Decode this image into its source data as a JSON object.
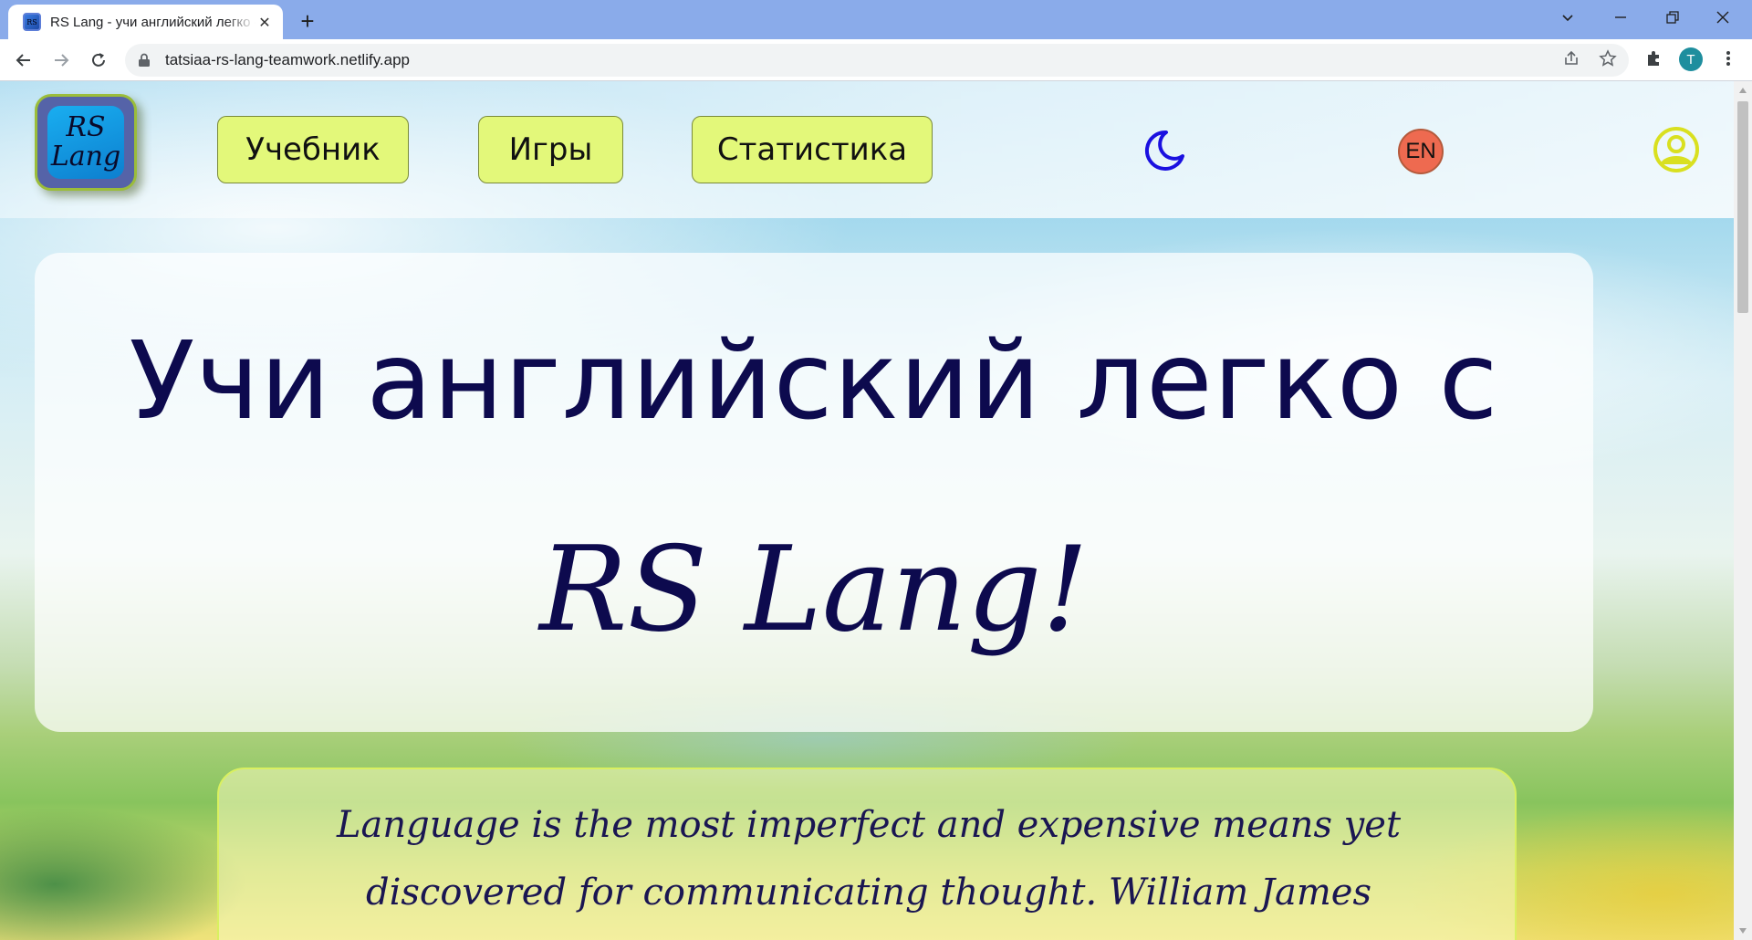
{
  "browser": {
    "tab_title": "RS Lang - учи английский легко с RS Lang!",
    "url": "tatsiaa-rs-lang-teamwork.netlify.app",
    "profile_initial": "T"
  },
  "header": {
    "logo_line1": "RS",
    "logo_line2": "Lang",
    "nav": {
      "textbook": "Учебник",
      "games": "Игры",
      "statistics": "Статистика"
    },
    "language_button": "EN"
  },
  "hero": {
    "line1": "Учи английский легко с",
    "line2": "RS Lang!"
  },
  "quote": {
    "text": "Language is the most imperfect and expensive means yet discovered for communicating thought. William James"
  },
  "colors": {
    "nav_pill": "#e3f87a",
    "heading": "#0d0a4e",
    "lang_button": "#ee6a50",
    "moon_icon": "#1a10e0",
    "user_icon": "#d9e020"
  }
}
